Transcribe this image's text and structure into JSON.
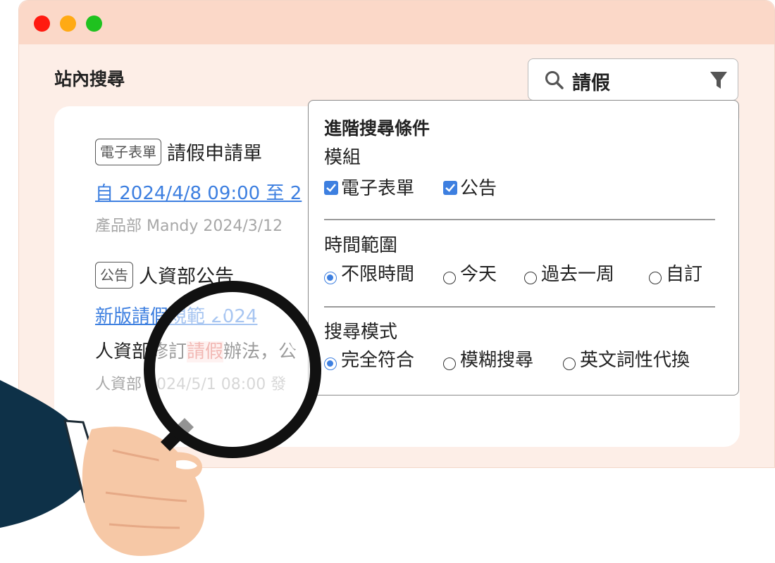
{
  "window": {
    "controls": {
      "close_color": "#ff1a10",
      "minimize_color": "#ffaa14",
      "maximize_color": "#1fc21f"
    }
  },
  "page": {
    "title": "站內搜尋"
  },
  "search": {
    "query": "請假",
    "search_icon": "search-icon",
    "filter_icon": "filter-icon"
  },
  "results": [
    {
      "tag": "電子表單",
      "title": "請假申請單",
      "link": "自 2024/4/8 09:00 至 2",
      "meta": "產品部  Mandy 2024/3/12"
    },
    {
      "tag": "公告",
      "title": "人資部公告",
      "link": "新版請假規範 2024",
      "body_prefix": "人資部修訂",
      "body_highlight": "請假",
      "body_suffix": "辦法，公",
      "meta": "人資部 2024/5/1  08:00  發"
    }
  ],
  "advanced": {
    "title": "進階搜尋條件",
    "module": {
      "label": "模組",
      "options": [
        {
          "label": "電子表單",
          "checked": true
        },
        {
          "label": "公告",
          "checked": true
        }
      ]
    },
    "time": {
      "label": "時間範圍",
      "options": [
        {
          "label": "不限時間",
          "selected": true
        },
        {
          "label": "今天",
          "selected": false
        },
        {
          "label": "過去一周",
          "selected": false
        },
        {
          "label": "自訂",
          "selected": false
        }
      ]
    },
    "mode": {
      "label": "搜尋模式",
      "options": [
        {
          "label": "完全符合",
          "selected": true
        },
        {
          "label": "模糊搜尋",
          "selected": false
        },
        {
          "label": "英文詞性代換",
          "selected": false
        }
      ]
    }
  },
  "colors": {
    "accent": "#3d7fe0",
    "highlight": "#e2635a",
    "titlebar": "#fbd8c8",
    "window_bg": "#fdeee7"
  }
}
